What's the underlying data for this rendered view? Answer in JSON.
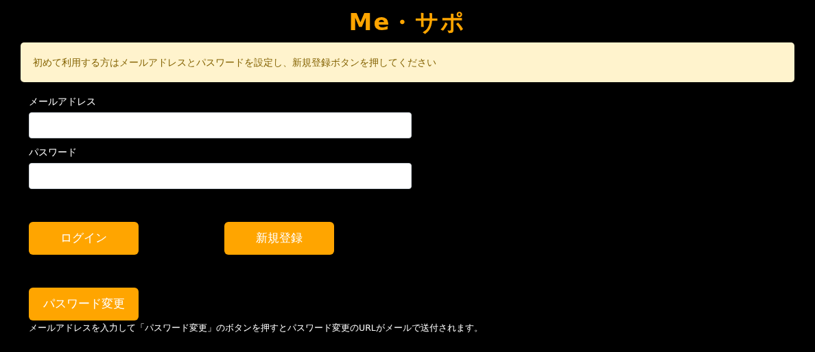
{
  "logo": "Me・サポ",
  "notice": "初めて利用する方はメールアドレスとパスワードを設定し、新規登録ボタンを押してください",
  "fields": [
    {
      "label": "メールアドレス"
    },
    {
      "label": "パスワード"
    }
  ],
  "buttons": [
    {
      "label": "ログイン"
    },
    {
      "label": "新規登録"
    }
  ],
  "password_change": {
    "button": "パスワード変更",
    "note": "メールアドレスを入力して「パスワード変更」のボタンを押すとパスワード変更のURLがメールで送付されます。"
  }
}
